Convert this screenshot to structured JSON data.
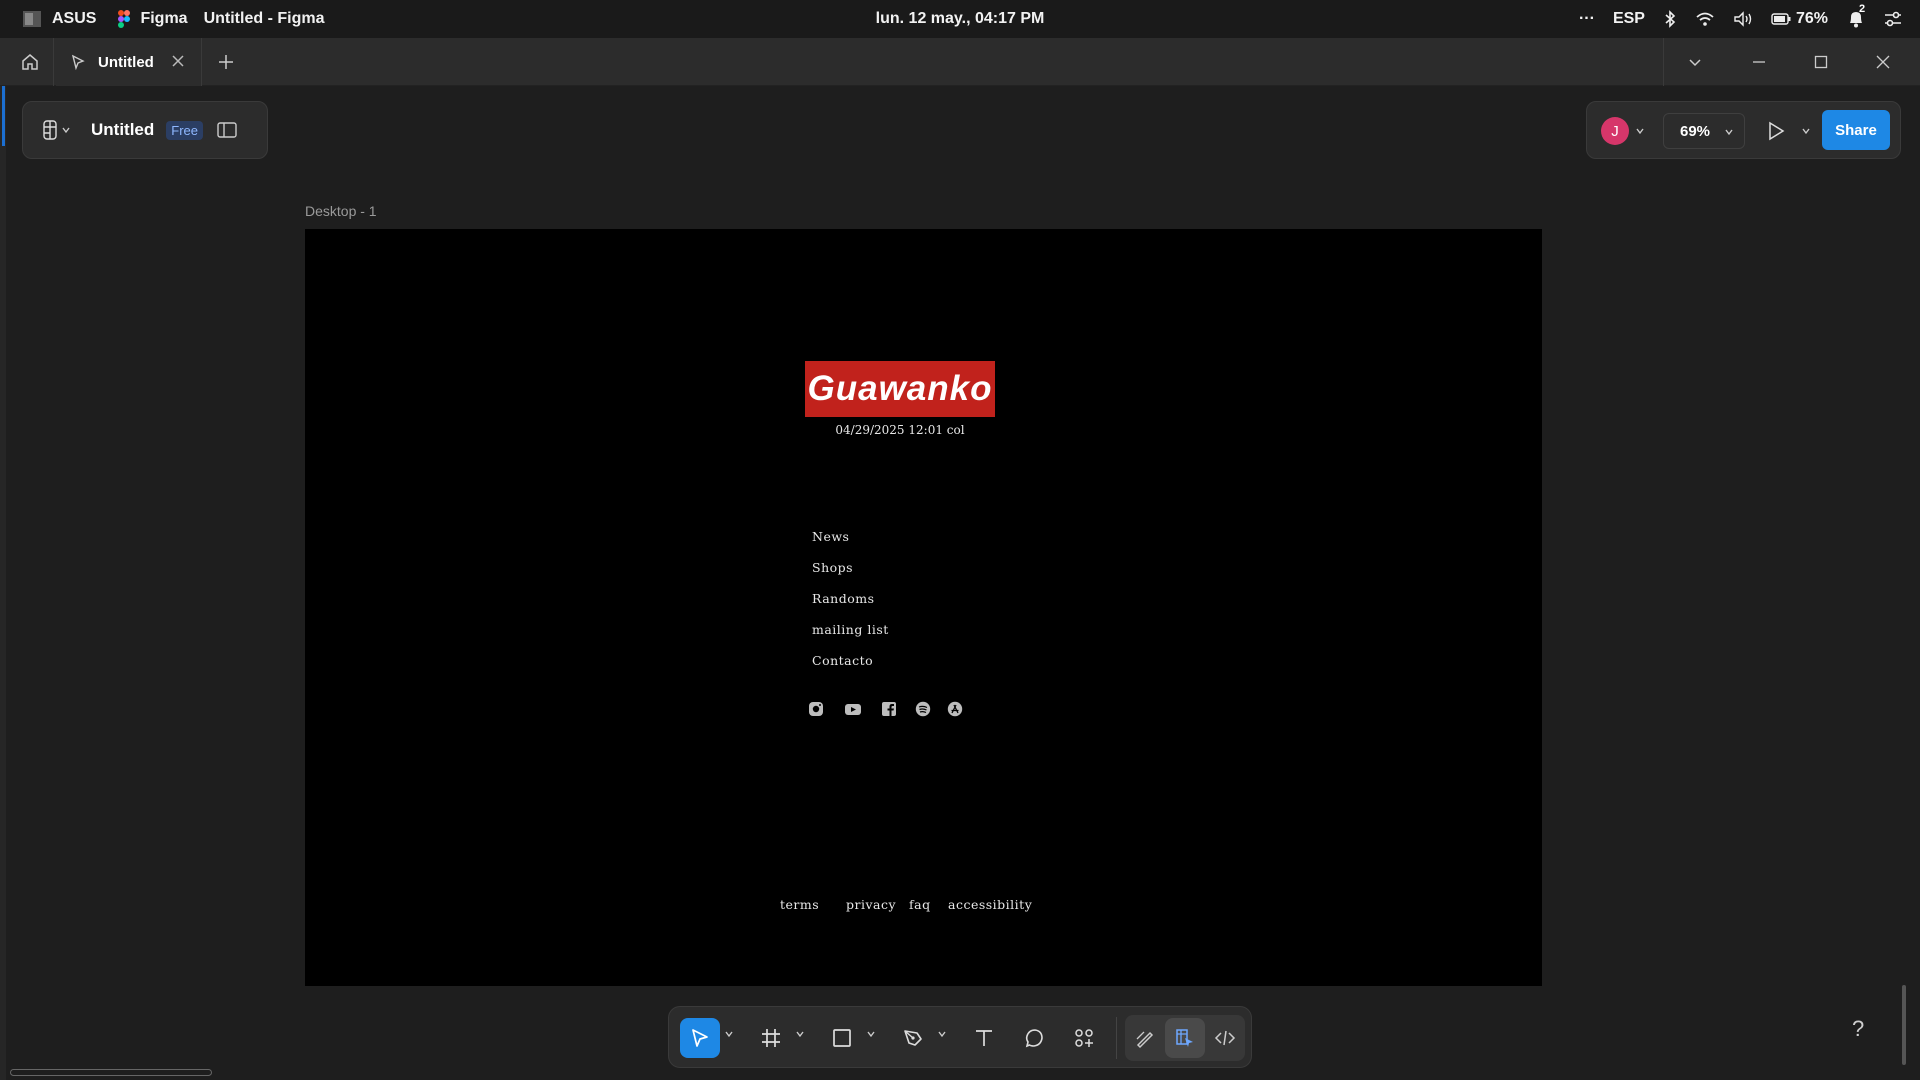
{
  "system_bar": {
    "brand": "ASUS",
    "app_name": "Figma",
    "window_title": "Untitled - Figma",
    "datetime": "lun. 12 may., 04:17 PM",
    "more": "···",
    "language": "ESP",
    "battery": "76%",
    "notification_count": "2"
  },
  "tabs": {
    "active_tab_label": "Untitled"
  },
  "file": {
    "name": "Untitled",
    "plan_badge": "Free"
  },
  "header_right": {
    "avatar_initial": "J",
    "zoom": "69%",
    "share_label": "Share"
  },
  "frame": {
    "label": "Desktop - 1",
    "logo_text": "Guawanko",
    "datetime_text": "04/29/2025  12:01 col",
    "menu": [
      "News",
      "Shops",
      "Randoms",
      "mailing list",
      "Contacto"
    ],
    "social_icons": [
      "instagram-icon",
      "youtube-icon",
      "facebook-icon",
      "spotify-icon",
      "appstore-icon"
    ],
    "footer_links": [
      "terms",
      "privacy",
      "faq",
      "accessibility"
    ]
  },
  "help_label": "?",
  "colors": {
    "accent": "#1e88e5",
    "logo_bg": "#c1221c",
    "avatar": "#d6366a",
    "canvas": "#1e1e1e"
  }
}
